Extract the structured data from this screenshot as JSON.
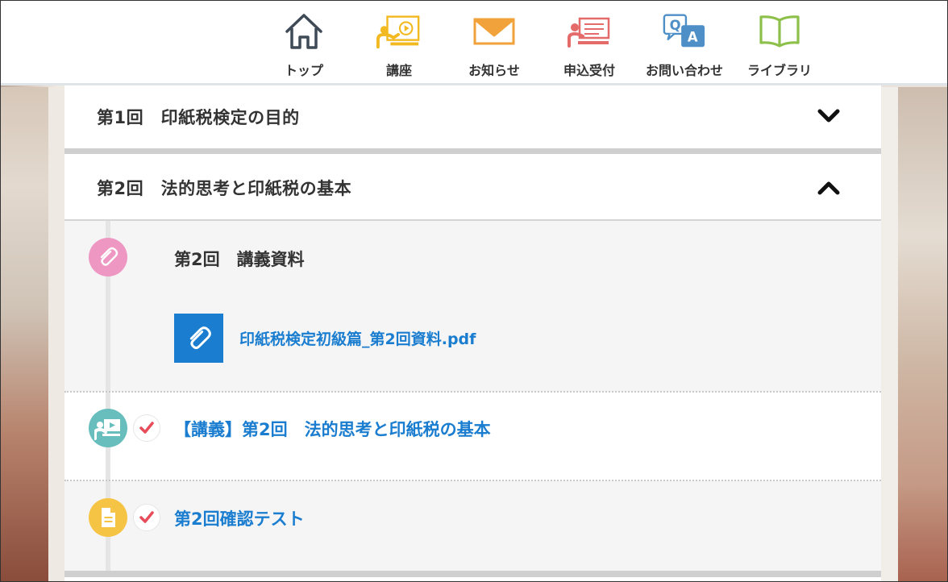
{
  "nav": {
    "items": [
      {
        "label": "トップ",
        "icon": "home-icon"
      },
      {
        "label": "講座",
        "icon": "lecture-board-icon"
      },
      {
        "label": "お知らせ",
        "icon": "envelope-icon"
      },
      {
        "label": "申込受付",
        "icon": "application-presenter-icon"
      },
      {
        "label": "お問い合わせ",
        "icon": "qa-icon"
      },
      {
        "label": "ライブラリ",
        "icon": "book-icon"
      }
    ],
    "colors": {
      "home": "#3f4a57",
      "lecture": "#f2b920",
      "mail": "#f2a23a",
      "apply": "#e56b6b",
      "qa": "#4e8fc7",
      "book": "#8cc04a"
    }
  },
  "accordion": [
    {
      "title": "第1回　印紙税検定の目的",
      "state": "collapsed",
      "chevron": "chevron-down-icon"
    },
    {
      "title": "第2回　法的思考と印紙税の基本",
      "state": "expanded",
      "chevron": "chevron-up-icon"
    }
  ],
  "lesson2": {
    "materials": {
      "heading": "第2回　講義資料",
      "icon": "paperclip-icon",
      "icon_color": "#ee97c3",
      "file_name": "印紙税検定初級篇_第2回資料.pdf",
      "file_icon_color": "#1a7dcf"
    },
    "lecture": {
      "title": "【講義】第2回　法的思考と印紙税の基本",
      "icon": "video-lecture-icon",
      "icon_color": "#68bdbd",
      "completed": true
    },
    "test": {
      "title": "第2回確認テスト",
      "icon": "document-icon",
      "icon_color": "#f6c444",
      "completed": true
    }
  },
  "colors": {
    "link": "#1a7dcf",
    "check": "#e74c5a",
    "text": "#333333"
  }
}
